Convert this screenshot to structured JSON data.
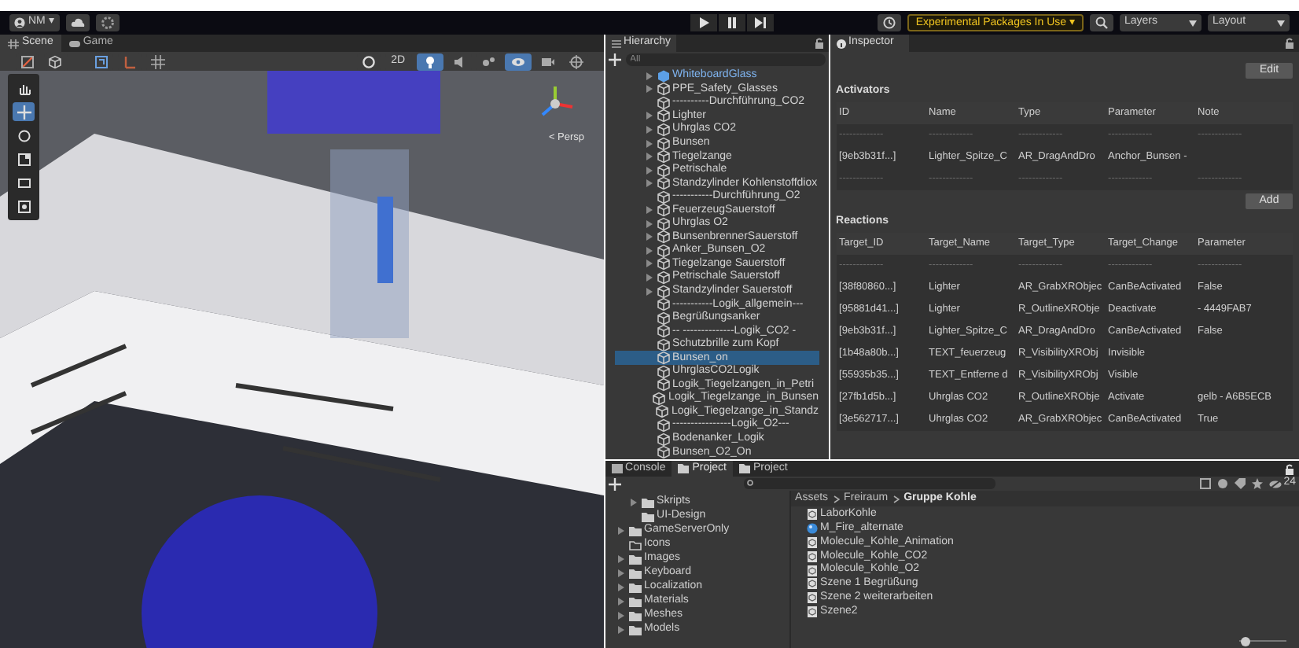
{
  "toolbar": {
    "account": "NM ▾",
    "experimental": "Experimental Packages In Use ▾",
    "layers": "Layers",
    "layout": "Layout"
  },
  "scene_tabs": [
    {
      "label": "Scene",
      "selected": true
    },
    {
      "label": "Game",
      "selected": false
    }
  ],
  "scene_toolbar": {
    "mode_2d": "2D",
    "persp": "< Persp"
  },
  "hierarchy": {
    "title": "Hierarchy",
    "search_placeholder": "All",
    "items": [
      {
        "label": "WhiteboardGlass",
        "expandable": true,
        "prefab": true,
        "selected": false
      },
      {
        "label": "PPE_Safety_Glasses",
        "expandable": true,
        "prefab": false,
        "selected": false
      },
      {
        "label": "----------Durchführung_CO2",
        "expandable": false,
        "prefab": false,
        "selected": false
      },
      {
        "label": "Lighter",
        "expandable": true,
        "prefab": false,
        "selected": false
      },
      {
        "label": "Uhrglas CO2",
        "expandable": true,
        "prefab": false,
        "selected": false
      },
      {
        "label": "Bunsen",
        "expandable": true,
        "prefab": false,
        "selected": false
      },
      {
        "label": "Tiegelzange",
        "expandable": true,
        "prefab": false,
        "selected": false
      },
      {
        "label": "Petrischale",
        "expandable": true,
        "prefab": false,
        "selected": false
      },
      {
        "label": "Standzylinder Kohlenstoffdiox",
        "expandable": true,
        "prefab": false,
        "selected": false
      },
      {
        "label": "-----------Durchführung_O2",
        "expandable": false,
        "prefab": false,
        "selected": false
      },
      {
        "label": "FeuerzeugSauerstoff",
        "expandable": true,
        "prefab": false,
        "selected": false
      },
      {
        "label": "Uhrglas O2",
        "expandable": true,
        "prefab": false,
        "selected": false
      },
      {
        "label": "BunsenbrennerSauerstoff",
        "expandable": true,
        "prefab": false,
        "selected": false
      },
      {
        "label": "Anker_Bunsen_O2",
        "expandable": true,
        "prefab": false,
        "selected": false
      },
      {
        "label": "Tiegelzange Sauerstoff",
        "expandable": true,
        "prefab": false,
        "selected": false
      },
      {
        "label": "Petrischale Sauerstoff",
        "expandable": true,
        "prefab": false,
        "selected": false
      },
      {
        "label": "Standzylinder Sauerstoff",
        "expandable": true,
        "prefab": false,
        "selected": false
      },
      {
        "label": "-----------Logik_allgemein---",
        "expandable": false,
        "prefab": false,
        "selected": false
      },
      {
        "label": "Begrüßungsanker",
        "expandable": false,
        "prefab": false,
        "selected": false
      },
      {
        "label": "-- --------------Logik_CO2 -",
        "expandable": false,
        "prefab": false,
        "selected": false
      },
      {
        "label": "Schutzbrille zum Kopf",
        "expandable": false,
        "prefab": false,
        "selected": false
      },
      {
        "label": "Bunsen_on",
        "expandable": false,
        "prefab": false,
        "selected": true
      },
      {
        "label": "UhrglasCO2Logik",
        "expandable": false,
        "prefab": false,
        "selected": false
      },
      {
        "label": "Logik_Tiegelzangen_in_Petri",
        "expandable": false,
        "prefab": false,
        "selected": false
      },
      {
        "label": "Logik_Tiegelzange_in_Bunsen",
        "expandable": false,
        "prefab": false,
        "selected": false
      },
      {
        "label": "Logik_Tiegelzange_in_Standz",
        "expandable": false,
        "prefab": false,
        "selected": false
      },
      {
        "label": "----------------Logik_O2---",
        "expandable": false,
        "prefab": false,
        "selected": false
      },
      {
        "label": "Bodenanker_Logik",
        "expandable": false,
        "prefab": false,
        "selected": false
      },
      {
        "label": "Bunsen_O2_On",
        "expandable": false,
        "prefab": false,
        "selected": false
      }
    ]
  },
  "inspector": {
    "title": "Inspector",
    "edit": "Edit",
    "add": "Add",
    "activators": {
      "title": "Activators",
      "columns": [
        "ID",
        "Name",
        "Type",
        "Parameter",
        "Note"
      ],
      "rows": [
        {
          "kind": "separator",
          "cells": [
            "-------------",
            "-------------",
            "-------------",
            "-------------",
            "-------------"
          ]
        },
        {
          "kind": "data",
          "cells": [
            "[9eb3b31f...]",
            "Lighter_Spitze_C",
            "AR_DragAndDro",
            "Anchor_Bunsen -",
            ""
          ]
        },
        {
          "kind": "separator",
          "cells": [
            "-------------",
            "-------------",
            "-------------",
            "-------------",
            "-------------"
          ]
        }
      ]
    },
    "reactions": {
      "title": "Reactions",
      "columns": [
        "Target_ID",
        "Target_Name",
        "Target_Type",
        "Target_Change",
        "Parameter"
      ],
      "rows": [
        {
          "kind": "separator",
          "cells": [
            "-------------",
            "-------------",
            "-------------",
            "-------------",
            "-------------"
          ]
        },
        {
          "kind": "data",
          "cells": [
            "[38f80860...]",
            "Lighter",
            "AR_GrabXRObjec",
            "CanBeActivated",
            "False"
          ]
        },
        {
          "kind": "data",
          "cells": [
            "[95881d41...]",
            "Lighter",
            "R_OutlineXRObje",
            "Deactivate",
            "- 4449FAB7"
          ]
        },
        {
          "kind": "data",
          "cells": [
            "[9eb3b31f...]",
            "Lighter_Spitze_C",
            "AR_DragAndDro",
            "CanBeActivated",
            "False"
          ]
        },
        {
          "kind": "data",
          "cells": [
            "[1b48a80b...]",
            "TEXT_feuerzeug",
            "R_VisibilityXRObj",
            "Invisible",
            ""
          ]
        },
        {
          "kind": "data",
          "cells": [
            "[55935b35...]",
            "TEXT_Entferne d",
            "R_VisibilityXRObj",
            "Visible",
            ""
          ]
        },
        {
          "kind": "data",
          "cells": [
            "[27fb1d5b...]",
            "Uhrglas CO2",
            "R_OutlineXRObje",
            "Activate",
            "gelb - A6B5ECB"
          ]
        },
        {
          "kind": "data",
          "cells": [
            "[3e562717...]",
            "Uhrglas CO2",
            "AR_GrabXRObjec",
            "CanBeActivated",
            "True"
          ]
        }
      ]
    }
  },
  "bottom_tabs": [
    {
      "label": "Console",
      "selected": false
    },
    {
      "label": "Project",
      "selected": true
    },
    {
      "label": "Project",
      "selected": false
    }
  ],
  "project": {
    "count": "24",
    "folders": [
      {
        "label": "Skripts",
        "expandable": true,
        "empty": false,
        "nested": true
      },
      {
        "label": "UI-Design",
        "expandable": false,
        "empty": false,
        "nested": true
      },
      {
        "label": "GameServerOnly",
        "expandable": true,
        "empty": false,
        "nested": false
      },
      {
        "label": "Icons",
        "expandable": false,
        "empty": true,
        "nested": false
      },
      {
        "label": "Images",
        "expandable": true,
        "empty": false,
        "nested": false
      },
      {
        "label": "Keyboard",
        "expandable": true,
        "empty": false,
        "nested": false
      },
      {
        "label": "Localization",
        "expandable": true,
        "empty": false,
        "nested": false
      },
      {
        "label": "Materials",
        "expandable": true,
        "empty": false,
        "nested": false
      },
      {
        "label": "Meshes",
        "expandable": true,
        "empty": false,
        "nested": false
      },
      {
        "label": "Models",
        "expandable": true,
        "empty": false,
        "nested": false
      }
    ],
    "breadcrumb": [
      "Assets",
      "Freiraum",
      "Gruppe Kohle"
    ],
    "files": [
      {
        "label": "LaborKohle",
        "kind": "asset"
      },
      {
        "label": "M_Fire_alternate",
        "kind": "material"
      },
      {
        "label": "Molecule_Kohle_Animation",
        "kind": "asset"
      },
      {
        "label": "Molecule_Kohle_CO2",
        "kind": "asset"
      },
      {
        "label": "Molecule_Kohle_O2",
        "kind": "asset"
      },
      {
        "label": "Szene 1 Begrüßung",
        "kind": "asset"
      },
      {
        "label": "Szene 2 weiterarbeiten",
        "kind": "asset"
      },
      {
        "label": "Szene2",
        "kind": "asset"
      }
    ],
    "zoom": {
      "level": 0.05
    }
  }
}
